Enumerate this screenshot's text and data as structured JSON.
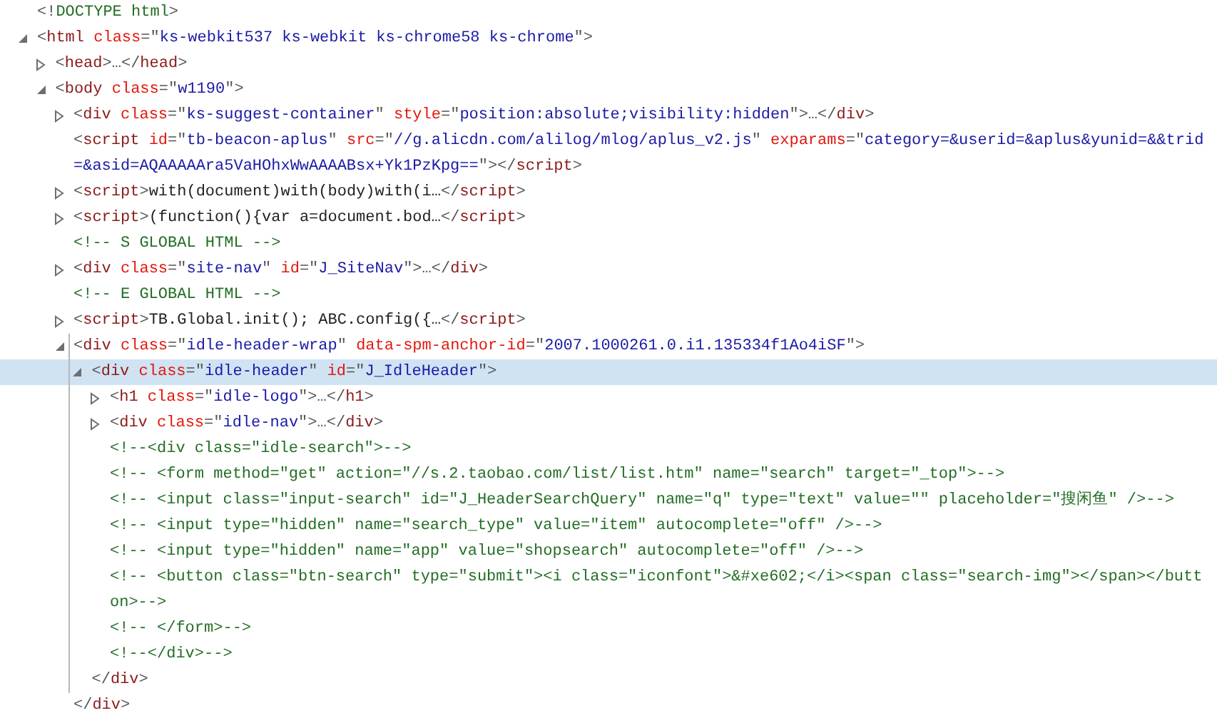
{
  "nodes": [
    {
      "selected": false,
      "tokens": [
        {
          "kind": "punct",
          "text": "<!"
        },
        {
          "kind": "comment",
          "text": "DOCTYPE html"
        },
        {
          "kind": "punct",
          "text": ">"
        }
      ]
    },
    {
      "expanded": true,
      "selected": false,
      "tokens": [
        {
          "kind": "punct",
          "text": "<"
        },
        {
          "kind": "tag",
          "text": "html "
        },
        {
          "kind": "attr",
          "text": "class"
        },
        {
          "kind": "punct",
          "text": "=\""
        },
        {
          "kind": "value",
          "text": "ks-webkit537 ks-webkit ks-chrome58 ks-chrome"
        },
        {
          "kind": "punct",
          "text": "\">"
        }
      ],
      "children": [
        {
          "expanded": false,
          "selected": false,
          "tokens": [
            {
              "kind": "punct",
              "text": "<"
            },
            {
              "kind": "tag",
              "text": "head"
            },
            {
              "kind": "punct",
              "text": ">…</"
            },
            {
              "kind": "tag",
              "text": "head"
            },
            {
              "kind": "punct",
              "text": ">"
            }
          ]
        },
        {
          "expanded": true,
          "selected": false,
          "tokens": [
            {
              "kind": "punct",
              "text": "<"
            },
            {
              "kind": "tag",
              "text": "body "
            },
            {
              "kind": "attr",
              "text": "class"
            },
            {
              "kind": "punct",
              "text": "=\""
            },
            {
              "kind": "value",
              "text": "w1190"
            },
            {
              "kind": "punct",
              "text": "\">"
            }
          ],
          "children": [
            {
              "expanded": false,
              "selected": false,
              "tokens": [
                {
                  "kind": "punct",
                  "text": "<"
                },
                {
                  "kind": "tag",
                  "text": "div "
                },
                {
                  "kind": "attr",
                  "text": "class"
                },
                {
                  "kind": "punct",
                  "text": "=\""
                },
                {
                  "kind": "value",
                  "text": "ks-suggest-container"
                },
                {
                  "kind": "punct",
                  "text": "\" "
                },
                {
                  "kind": "attr",
                  "text": "style"
                },
                {
                  "kind": "punct",
                  "text": "=\""
                },
                {
                  "kind": "value",
                  "text": "position:absolute;visibility:hidden"
                },
                {
                  "kind": "punct",
                  "text": "\">…</"
                },
                {
                  "kind": "tag",
                  "text": "div"
                },
                {
                  "kind": "punct",
                  "text": ">"
                }
              ]
            },
            {
              "selected": false,
              "tokens": [
                {
                  "kind": "punct",
                  "text": "<"
                },
                {
                  "kind": "tag",
                  "text": "script "
                },
                {
                  "kind": "attr",
                  "text": "id"
                },
                {
                  "kind": "punct",
                  "text": "=\""
                },
                {
                  "kind": "value",
                  "text": "tb-beacon-aplus"
                },
                {
                  "kind": "punct",
                  "text": "\" "
                },
                {
                  "kind": "attr",
                  "text": "src"
                },
                {
                  "kind": "punct",
                  "text": "=\""
                },
                {
                  "kind": "value",
                  "text": "//g.alicdn.com/alilog/mlog/aplus_v2.js"
                },
                {
                  "kind": "punct",
                  "text": "\" "
                },
                {
                  "kind": "attr",
                  "text": "exparams"
                },
                {
                  "kind": "punct",
                  "text": "=\""
                },
                {
                  "kind": "value",
                  "text": "category=&userid=&aplus&yunid=&&trid=&asid=AQAAAAAra5VaHOhxWwAAAABsx+Yk1PzKpg=="
                },
                {
                  "kind": "punct",
                  "text": "\"></"
                },
                {
                  "kind": "tag",
                  "text": "script"
                },
                {
                  "kind": "punct",
                  "text": ">"
                }
              ]
            },
            {
              "expanded": false,
              "selected": false,
              "tokens": [
                {
                  "kind": "punct",
                  "text": "<"
                },
                {
                  "kind": "tag",
                  "text": "script"
                },
                {
                  "kind": "punct",
                  "text": ">"
                },
                {
                  "kind": "text",
                  "text": "with(document)with(body)with(i…"
                },
                {
                  "kind": "punct",
                  "text": "</"
                },
                {
                  "kind": "tag",
                  "text": "script"
                },
                {
                  "kind": "punct",
                  "text": ">"
                }
              ]
            },
            {
              "expanded": false,
              "selected": false,
              "tokens": [
                {
                  "kind": "punct",
                  "text": "<"
                },
                {
                  "kind": "tag",
                  "text": "script"
                },
                {
                  "kind": "punct",
                  "text": ">"
                },
                {
                  "kind": "text",
                  "text": "(function(){var a=document.bod…"
                },
                {
                  "kind": "punct",
                  "text": "</"
                },
                {
                  "kind": "tag",
                  "text": "script"
                },
                {
                  "kind": "punct",
                  "text": ">"
                }
              ]
            },
            {
              "selected": false,
              "tokens": [
                {
                  "kind": "comment",
                  "text": "<!-- S GLOBAL HTML -->"
                }
              ]
            },
            {
              "expanded": false,
              "selected": false,
              "tokens": [
                {
                  "kind": "punct",
                  "text": "<"
                },
                {
                  "kind": "tag",
                  "text": "div "
                },
                {
                  "kind": "attr",
                  "text": "class"
                },
                {
                  "kind": "punct",
                  "text": "=\""
                },
                {
                  "kind": "value",
                  "text": "site-nav"
                },
                {
                  "kind": "punct",
                  "text": "\" "
                },
                {
                  "kind": "attr",
                  "text": "id"
                },
                {
                  "kind": "punct",
                  "text": "=\""
                },
                {
                  "kind": "value",
                  "text": "J_SiteNav"
                },
                {
                  "kind": "punct",
                  "text": "\">…</"
                },
                {
                  "kind": "tag",
                  "text": "div"
                },
                {
                  "kind": "punct",
                  "text": ">"
                }
              ]
            },
            {
              "selected": false,
              "tokens": [
                {
                  "kind": "comment",
                  "text": "<!-- E GLOBAL HTML -->"
                }
              ]
            },
            {
              "expanded": false,
              "selected": false,
              "tokens": [
                {
                  "kind": "punct",
                  "text": "<"
                },
                {
                  "kind": "tag",
                  "text": "script"
                },
                {
                  "kind": "punct",
                  "text": ">"
                },
                {
                  "kind": "text",
                  "text": "TB.Global.init(); ABC.config({…"
                },
                {
                  "kind": "punct",
                  "text": "</"
                },
                {
                  "kind": "tag",
                  "text": "script"
                },
                {
                  "kind": "punct",
                  "text": ">"
                }
              ]
            },
            {
              "expanded": true,
              "selected": false,
              "tokens": [
                {
                  "kind": "punct",
                  "text": "<"
                },
                {
                  "kind": "tag",
                  "text": "div "
                },
                {
                  "kind": "attr",
                  "text": "class"
                },
                {
                  "kind": "punct",
                  "text": "=\""
                },
                {
                  "kind": "value",
                  "text": "idle-header-wrap"
                },
                {
                  "kind": "punct",
                  "text": "\" "
                },
                {
                  "kind": "attr",
                  "text": "data-spm-anchor-id"
                },
                {
                  "kind": "punct",
                  "text": "=\""
                },
                {
                  "kind": "value",
                  "text": "2007.1000261.0.i1.135334f1Ao4iSF"
                },
                {
                  "kind": "punct",
                  "text": "\">"
                }
              ],
              "closing": [
                {
                  "kind": "punct",
                  "text": "</"
                },
                {
                  "kind": "tag",
                  "text": "div"
                },
                {
                  "kind": "punct",
                  "text": ">"
                }
              ],
              "children": [
                {
                  "expanded": true,
                  "selected": true,
                  "tokens": [
                    {
                      "kind": "punct",
                      "text": "<"
                    },
                    {
                      "kind": "tag",
                      "text": "div "
                    },
                    {
                      "kind": "attr",
                      "text": "class"
                    },
                    {
                      "kind": "punct",
                      "text": "=\""
                    },
                    {
                      "kind": "value",
                      "text": "idle-header"
                    },
                    {
                      "kind": "punct",
                      "text": "\" "
                    },
                    {
                      "kind": "attr",
                      "text": "id"
                    },
                    {
                      "kind": "punct",
                      "text": "=\""
                    },
                    {
                      "kind": "value",
                      "text": "J_IdleHeader"
                    },
                    {
                      "kind": "punct",
                      "text": "\">"
                    }
                  ],
                  "closing": [
                    {
                      "kind": "punct",
                      "text": "</"
                    },
                    {
                      "kind": "tag",
                      "text": "div"
                    },
                    {
                      "kind": "punct",
                      "text": ">"
                    }
                  ],
                  "children": [
                    {
                      "expanded": false,
                      "selected": false,
                      "tokens": [
                        {
                          "kind": "punct",
                          "text": "<"
                        },
                        {
                          "kind": "tag",
                          "text": "h1 "
                        },
                        {
                          "kind": "attr",
                          "text": "class"
                        },
                        {
                          "kind": "punct",
                          "text": "=\""
                        },
                        {
                          "kind": "value",
                          "text": "idle-logo"
                        },
                        {
                          "kind": "punct",
                          "text": "\">…</"
                        },
                        {
                          "kind": "tag",
                          "text": "h1"
                        },
                        {
                          "kind": "punct",
                          "text": ">"
                        }
                      ]
                    },
                    {
                      "expanded": false,
                      "selected": false,
                      "tokens": [
                        {
                          "kind": "punct",
                          "text": "<"
                        },
                        {
                          "kind": "tag",
                          "text": "div "
                        },
                        {
                          "kind": "attr",
                          "text": "class"
                        },
                        {
                          "kind": "punct",
                          "text": "=\""
                        },
                        {
                          "kind": "value",
                          "text": "idle-nav"
                        },
                        {
                          "kind": "punct",
                          "text": "\">…</"
                        },
                        {
                          "kind": "tag",
                          "text": "div"
                        },
                        {
                          "kind": "punct",
                          "text": ">"
                        }
                      ]
                    },
                    {
                      "selected": false,
                      "tokens": [
                        {
                          "kind": "comment",
                          "text": "<!--<div class=\"idle-search\">-->"
                        }
                      ]
                    },
                    {
                      "selected": false,
                      "tokens": [
                        {
                          "kind": "comment",
                          "text": "<!-- <form method=\"get\" action=\"//s.2.taobao.com/list/list.htm\" name=\"search\" target=\"_top\">-->"
                        }
                      ]
                    },
                    {
                      "selected": false,
                      "tokens": [
                        {
                          "kind": "comment",
                          "text": "<!-- <input class=\"input-search\" id=\"J_HeaderSearchQuery\" name=\"q\" type=\"text\" value=\"\" placeholder=\"搜闲鱼\" />-->"
                        }
                      ]
                    },
                    {
                      "selected": false,
                      "tokens": [
                        {
                          "kind": "comment",
                          "text": "<!-- <input type=\"hidden\" name=\"search_type\" value=\"item\" autocomplete=\"off\" />-->"
                        }
                      ]
                    },
                    {
                      "selected": false,
                      "tokens": [
                        {
                          "kind": "comment",
                          "text": "<!-- <input type=\"hidden\" name=\"app\" value=\"shopsearch\" autocomplete=\"off\" />-->"
                        }
                      ]
                    },
                    {
                      "selected": false,
                      "tokens": [
                        {
                          "kind": "comment",
                          "text": "<!-- <button class=\"btn-search\" type=\"submit\"><i class=\"iconfont\">&#xe602;</i><span class=\"search-img\"></span></button>-->"
                        }
                      ]
                    },
                    {
                      "selected": false,
                      "tokens": [
                        {
                          "kind": "comment",
                          "text": "<!-- </form>-->"
                        }
                      ]
                    },
                    {
                      "selected": false,
                      "tokens": [
                        {
                          "kind": "comment",
                          "text": "<!--</div>-->"
                        }
                      ]
                    }
                  ]
                }
              ]
            }
          ]
        }
      ]
    }
  ]
}
